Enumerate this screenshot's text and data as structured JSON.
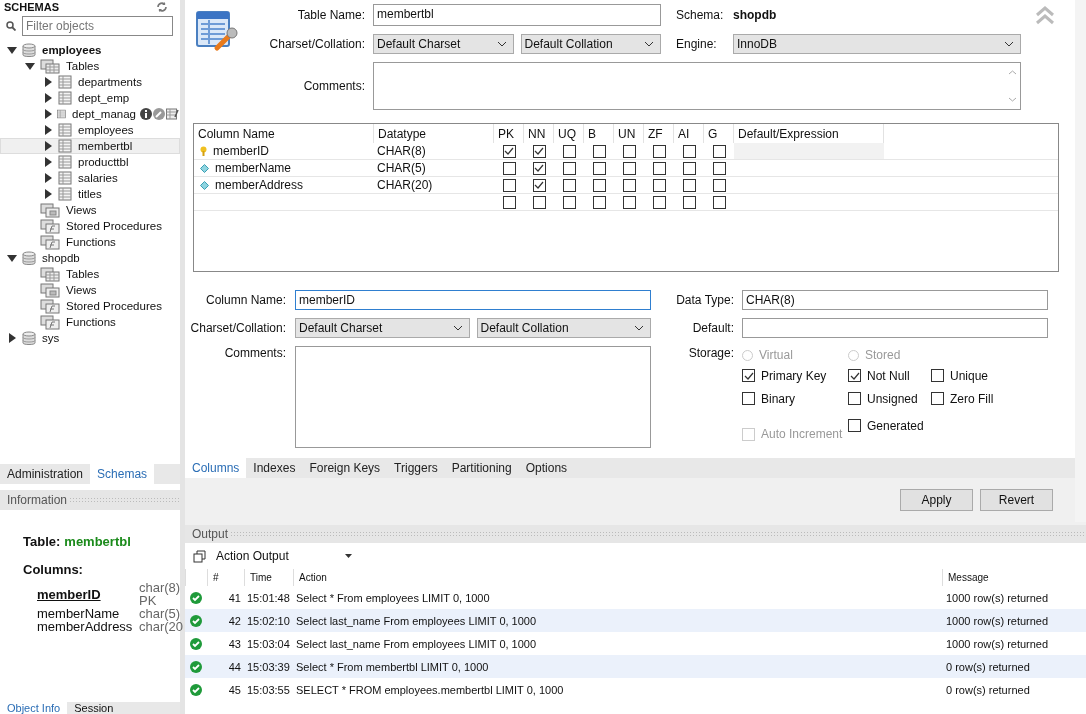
{
  "sidebar": {
    "title": "SCHEMAS",
    "filter": {
      "placeholder": "Filter objects"
    },
    "tree": [
      {
        "label": "employees",
        "kind": "schema",
        "bold": true,
        "expanded": true,
        "selected": false,
        "children": [
          {
            "label": "Tables",
            "kind": "tables",
            "expanded": true,
            "selected": false,
            "children": [
              {
                "label": "departments",
                "kind": "table",
                "expanded": false,
                "selected": false
              },
              {
                "label": "dept_emp",
                "kind": "table",
                "expanded": false,
                "selected": false
              },
              {
                "label": "dept_manag",
                "kind": "table",
                "expanded": false,
                "selected": false,
                "show_actions": true
              },
              {
                "label": "employees",
                "kind": "table",
                "expanded": false,
                "selected": false
              },
              {
                "label": "membertbl",
                "kind": "table",
                "expanded": false,
                "selected": true
              },
              {
                "label": "producttbl",
                "kind": "table",
                "expanded": false,
                "selected": false
              },
              {
                "label": "salaries",
                "kind": "table",
                "expanded": false,
                "selected": false
              },
              {
                "label": "titles",
                "kind": "table",
                "expanded": false,
                "selected": false
              }
            ]
          },
          {
            "label": "Views",
            "kind": "views",
            "selected": false
          },
          {
            "label": "Stored Procedures",
            "kind": "routines",
            "selected": false
          },
          {
            "label": "Functions",
            "kind": "routines",
            "selected": false
          }
        ]
      },
      {
        "label": "shopdb",
        "kind": "schema",
        "bold": false,
        "expanded": true,
        "selected": false,
        "children": [
          {
            "label": "Tables",
            "kind": "tables",
            "selected": false
          },
          {
            "label": "Views",
            "kind": "views",
            "selected": false
          },
          {
            "label": "Stored Procedures",
            "kind": "routines",
            "selected": false
          },
          {
            "label": "Functions",
            "kind": "routines",
            "selected": false
          }
        ]
      },
      {
        "label": "sys",
        "kind": "schema",
        "bold": false,
        "expanded": false,
        "selected": false
      }
    ],
    "tabs": [
      {
        "label": "Administration",
        "selected": false
      },
      {
        "label": "Schemas",
        "selected": true
      }
    ],
    "information": {
      "title": "Information",
      "table_label": "Table:",
      "table_name": "membertbl",
      "columns_label": "Columns:",
      "columns": [
        {
          "name": "memberID",
          "type": "char(8)",
          "primary": true,
          "key": "PK"
        },
        {
          "name": "memberName",
          "type": "char(5)",
          "primary": false
        },
        {
          "name": "memberAddress",
          "type": "char(20",
          "primary": false
        }
      ]
    },
    "bottom_tabs": [
      {
        "label": "Object Info",
        "selected": true
      },
      {
        "label": "Session",
        "selected": false
      }
    ]
  },
  "editor": {
    "table_name_label": "Table Name:",
    "table_name": "membertbl",
    "schema_label": "Schema:",
    "schema": "shopdb",
    "charset_label": "Charset/Collation:",
    "charset": "Default Charset",
    "collation": "Default Collation",
    "engine_label": "Engine:",
    "engine": "InnoDB",
    "comments_label": "Comments:",
    "grid": {
      "columns": [
        "Column Name",
        "Datatype",
        "PK",
        "NN",
        "UQ",
        "B",
        "UN",
        "ZF",
        "AI",
        "G",
        "Default/Expression"
      ],
      "rows": [
        {
          "name": "memberID",
          "kind": "primary_key",
          "datatype": "CHAR(8)",
          "flags": [
            true,
            true,
            false,
            false,
            false,
            false,
            false,
            false
          ],
          "selected": true
        },
        {
          "name": "memberName",
          "kind": "column",
          "datatype": "CHAR(5)",
          "flags": [
            false,
            true,
            false,
            false,
            false,
            false,
            false,
            false
          ],
          "selected": false
        },
        {
          "name": "memberAddress",
          "kind": "column",
          "datatype": "CHAR(20)",
          "flags": [
            false,
            true,
            false,
            false,
            false,
            false,
            false,
            false
          ],
          "selected": false
        },
        {
          "flags": [
            false,
            false,
            false,
            false,
            false,
            false,
            false,
            false
          ],
          "selected": false
        }
      ]
    },
    "detail": {
      "column_name_label": "Column Name:",
      "column_name": "memberID",
      "charset_label": "Charset/Collation:",
      "charset": "Default Charset",
      "collation": "Default Collation",
      "comments_label": "Comments:",
      "data_type_label": "Data Type:",
      "data_type": "CHAR(8)",
      "default_label": "Default:",
      "storage_label": "Storage:",
      "storage": [
        {
          "label": "Virtual",
          "selected": false,
          "disabled": true
        },
        {
          "label": "Stored",
          "selected": false,
          "disabled": true
        }
      ],
      "options": [
        {
          "label": "Primary Key",
          "checked": true,
          "disabled": false
        },
        {
          "label": "Not Null",
          "checked": true,
          "disabled": false
        },
        {
          "label": "Unique",
          "checked": false,
          "disabled": false
        },
        {
          "label": "Binary",
          "checked": false,
          "disabled": false
        },
        {
          "label": "Unsigned",
          "checked": false,
          "disabled": false
        },
        {
          "label": "Zero Fill",
          "checked": false,
          "disabled": false
        },
        {
          "label": "Auto Increment",
          "checked": false,
          "disabled": true
        },
        {
          "label": "Generated",
          "checked": false,
          "disabled": false
        }
      ]
    },
    "tabs": [
      {
        "label": "Columns",
        "selected": true
      },
      {
        "label": "Indexes",
        "selected": false
      },
      {
        "label": "Foreign Keys",
        "selected": false
      },
      {
        "label": "Triggers",
        "selected": false
      },
      {
        "label": "Partitioning",
        "selected": false
      },
      {
        "label": "Options",
        "selected": false
      }
    ],
    "buttons": [
      "Apply",
      "Revert"
    ]
  },
  "output": {
    "title": "Output",
    "selector": "Action Output",
    "columns": [
      "#",
      "Time",
      "Action",
      "Message"
    ],
    "rows": [
      {
        "kind": "success",
        "num": "41",
        "time": "15:01:48",
        "action": "Select * From employees LIMIT 0, 1000",
        "message": "1000 row(s) returned"
      },
      {
        "kind": "success",
        "num": "42",
        "time": "15:02:10",
        "action": "Select last_name From employees LIMIT 0, 1000",
        "message": "1000 row(s) returned"
      },
      {
        "kind": "success",
        "num": "43",
        "time": "15:03:04",
        "action": "Select last_name From employees LIMIT 0, 1000",
        "message": "1000 row(s) returned"
      },
      {
        "kind": "success",
        "num": "44",
        "time": "15:03:39",
        "action": "Select * From membertbl LIMIT 0, 1000",
        "message": "0 row(s) returned"
      },
      {
        "kind": "success",
        "num": "45",
        "time": "15:03:55",
        "action": "SELECT * FROM employees.membertbl LIMIT 0, 1000",
        "message": "0 row(s) returned"
      }
    ]
  }
}
